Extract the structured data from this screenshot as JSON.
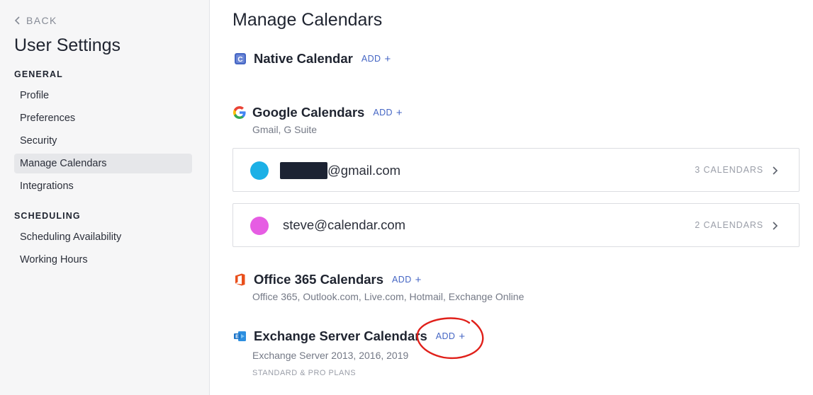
{
  "sidebar": {
    "back_label": "BACK",
    "title": "User Settings",
    "sections": [
      {
        "label": "GENERAL",
        "items": [
          {
            "label": "Profile",
            "active": false
          },
          {
            "label": "Preferences",
            "active": false
          },
          {
            "label": "Security",
            "active": false
          },
          {
            "label": "Manage Calendars",
            "active": true
          },
          {
            "label": "Integrations",
            "active": false
          }
        ]
      },
      {
        "label": "SCHEDULING",
        "items": [
          {
            "label": "Scheduling Availability",
            "active": false
          },
          {
            "label": "Working Hours",
            "active": false
          }
        ]
      }
    ]
  },
  "main": {
    "title": "Manage Calendars",
    "add_label": "ADD",
    "native": {
      "name": "Native Calendar",
      "icon": "native-calendar-icon"
    },
    "google": {
      "name": "Google Calendars",
      "subtitle": "Gmail, G Suite",
      "icon": "google-icon",
      "accounts": [
        {
          "email": "@gmail.com",
          "redacted": true,
          "count_label": "3 CALENDARS",
          "color": "#1cb0e6"
        },
        {
          "email": "steve@calendar.com",
          "redacted": false,
          "count_label": "2 CALENDARS",
          "color": "#e65de3"
        }
      ]
    },
    "office365": {
      "name": "Office 365 Calendars",
      "subtitle": "Office 365, Outlook.com, Live.com, Hotmail, Exchange Online",
      "icon": "office-365-icon"
    },
    "exchange": {
      "name": "Exchange Server Calendars",
      "subtitle": "Exchange Server 2013, 2016, 2019",
      "plan_note": "STANDARD & PRO PLANS",
      "icon": "exchange-icon"
    }
  },
  "colors": {
    "accent": "#4566c4",
    "annotation": "#e0201a",
    "office_orange": "#e94f1b",
    "exchange_blue": "#1b74c8"
  }
}
